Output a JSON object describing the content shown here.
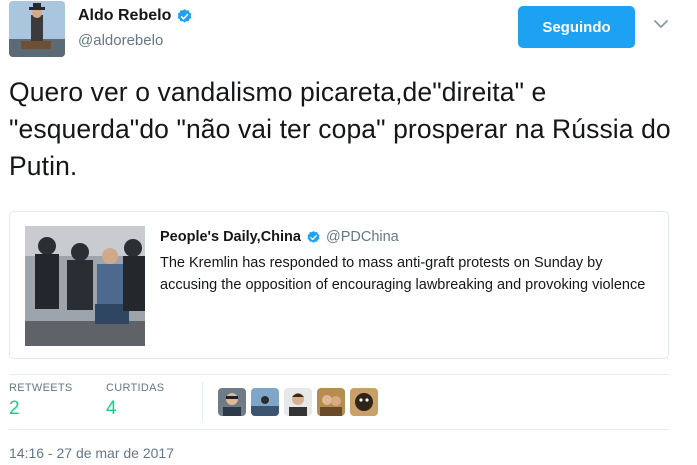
{
  "author": {
    "name": "Aldo Rebelo",
    "handle": "@aldorebelo",
    "verified_icon": "verified-badge-icon",
    "avatar_icon": "avatar-photo"
  },
  "follow_button": {
    "label": "Seguindo",
    "color": "#1da1f2"
  },
  "menu_icon": "chevron-down-icon",
  "tweet": {
    "text": "Quero ver o vandalismo picareta,de\"direita\" e \"esquerda\"do \"não vai ter copa\" prosperar na Rússia do Putin."
  },
  "quoted_tweet": {
    "name": "People's Daily,China",
    "handle": "@PDChina",
    "text": "The Kremlin has responded to mass anti-graft protests on Sunday by accusing the opposition of encouraging lawbreaking and provoking violence"
  },
  "stats": {
    "retweets_label": "RETWEETS",
    "retweets_value": "2",
    "likes_label": "CURTIDAS",
    "likes_value": "4",
    "likes_value_color": "#19cf86"
  },
  "timestamp": "14:16 - 27 de mar de 2017"
}
